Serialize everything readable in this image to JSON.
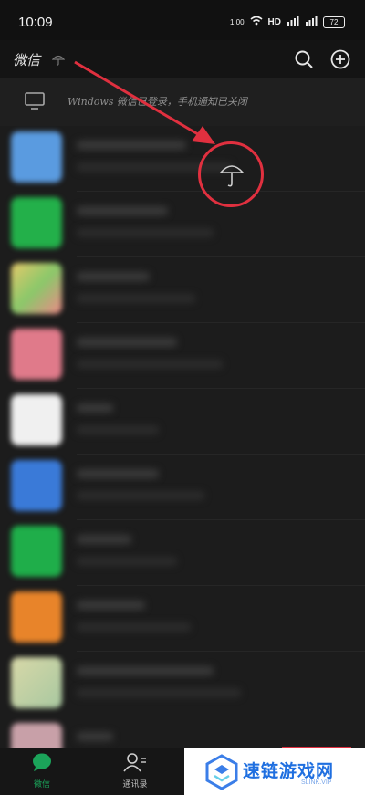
{
  "status_bar": {
    "time": "10:09",
    "speed": "1.00",
    "hd_label": "HD",
    "battery": "72"
  },
  "header": {
    "title": "微信",
    "title_icon": "umbrella-icon",
    "search_icon": "search-icon",
    "add_icon": "plus-circle-icon"
  },
  "notice": {
    "icon": "desktop-icon",
    "text": "Windows 微信已登录，手机通知已关闭"
  },
  "highlight": {
    "icon": "umbrella-icon",
    "color": "#e0303f"
  },
  "chat_avatars": [
    "#5a9be0",
    "#23b04a",
    "#e6c96a",
    "#e07a8a",
    "#f0f0f0",
    "#3a7ad8",
    "#1fae4a",
    "#e8842a",
    "#d8d8a8",
    "#c8a0a8"
  ],
  "tabbar": {
    "tabs": [
      {
        "label": "微信",
        "icon": "chat-bubble-icon",
        "active": true
      },
      {
        "label": "通讯录",
        "icon": "contacts-icon",
        "active": false
      }
    ]
  },
  "watermark": {
    "brand": "速链游戏网",
    "domain": "SLINK.VIP"
  }
}
